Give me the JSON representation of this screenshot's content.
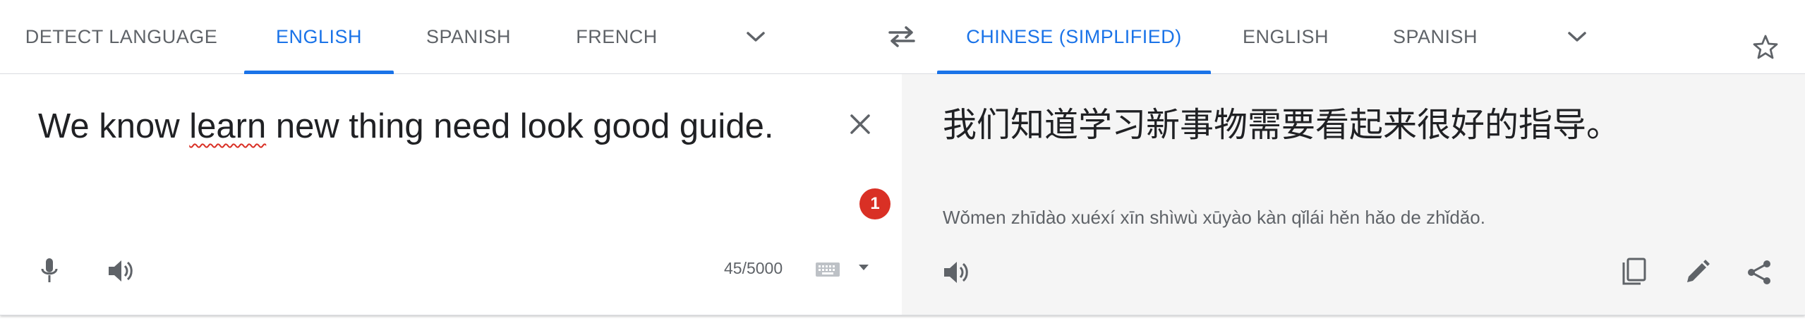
{
  "source_langs": {
    "detect": "DETECT LANGUAGE",
    "english": "ENGLISH",
    "spanish": "SPANISH",
    "french": "FRENCH"
  },
  "target_langs": {
    "chinese": "CHINESE (SIMPLIFIED)",
    "english": "ENGLISH",
    "spanish": "SPANISH"
  },
  "source": {
    "text_before": "We know ",
    "text_misspelled": "learn",
    "text_after": " new thing need look good guide.",
    "char_count": "45/5000",
    "badge_count": "1"
  },
  "target": {
    "translation": "我们知道学习新事物需要看起来很好的指导。",
    "transliteration": "Wǒmen zhīdào xuéxí xīn shìwù xūyào kàn qǐlái hěn hǎo de zhǐdǎo."
  },
  "colors": {
    "accent": "#1a73e8",
    "error": "#d93025",
    "target_bg": "#f5f5f5"
  },
  "icons": [
    "chevron-down-icon",
    "swap-icon",
    "close-icon",
    "mic-icon",
    "speaker-icon",
    "keyboard-icon",
    "star-icon",
    "copy-icon",
    "edit-icon",
    "share-icon"
  ]
}
